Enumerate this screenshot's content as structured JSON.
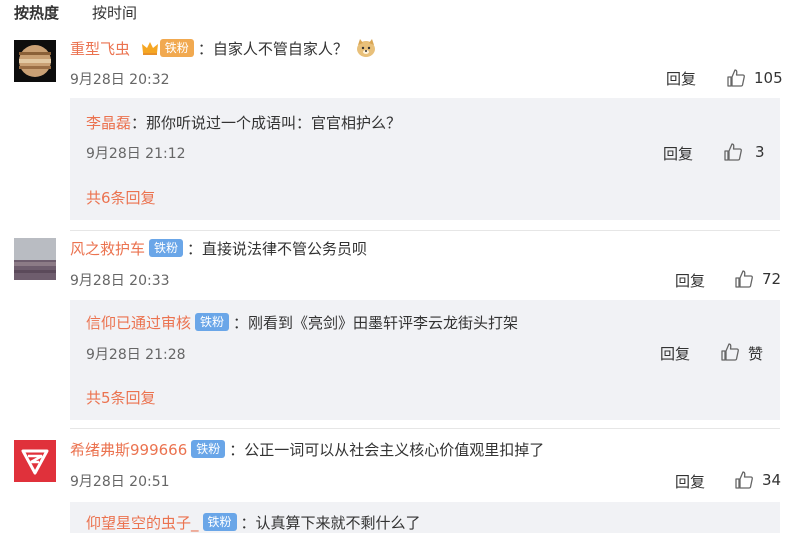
{
  "sort": {
    "hot": "按热度",
    "time": "按时间"
  },
  "comments": [
    {
      "user": "重型飞虫",
      "badge": "铁粉",
      "text": "：自家人不管自家人？",
      "time": "9月28日 20:32",
      "reply_label": "回复",
      "likes": "105",
      "replies": [
        {
          "user": "李晶磊",
          "text": "：那你听说过一个成语叫：官官相护么？",
          "time": "9月28日 21:12",
          "reply_label": "回复",
          "likes": "3"
        }
      ],
      "more": "共6条回复"
    },
    {
      "user": "风之救护车",
      "badge": "铁粉",
      "text": "：直接说法律不管公务员呗",
      "time": "9月28日 20:33",
      "reply_label": "回复",
      "likes": "72",
      "replies": [
        {
          "user": "信仰已通过审核",
          "badge": "铁粉",
          "text": "：刚看到《亮剑》田墨轩评李云龙街头打架",
          "time": "9月28日 21:28",
          "reply_label": "回复",
          "likes": "赞"
        }
      ],
      "more": "共5条回复"
    },
    {
      "user": "希绪弗斯999666",
      "badge": "铁粉",
      "text": "：公正一词可以从社会主义核心价值观里扣掉了",
      "time": "9月28日 20:51",
      "reply_label": "回复",
      "likes": "34",
      "replies": [
        {
          "user": "仰望星空的虫子_",
          "badge": "铁粉",
          "text": "：认真算下来就不剩什么了"
        }
      ]
    }
  ],
  "colors": {
    "username": "#eb7350",
    "badge": "#6aa6e8",
    "reply_bg": "#f1f2f5"
  }
}
